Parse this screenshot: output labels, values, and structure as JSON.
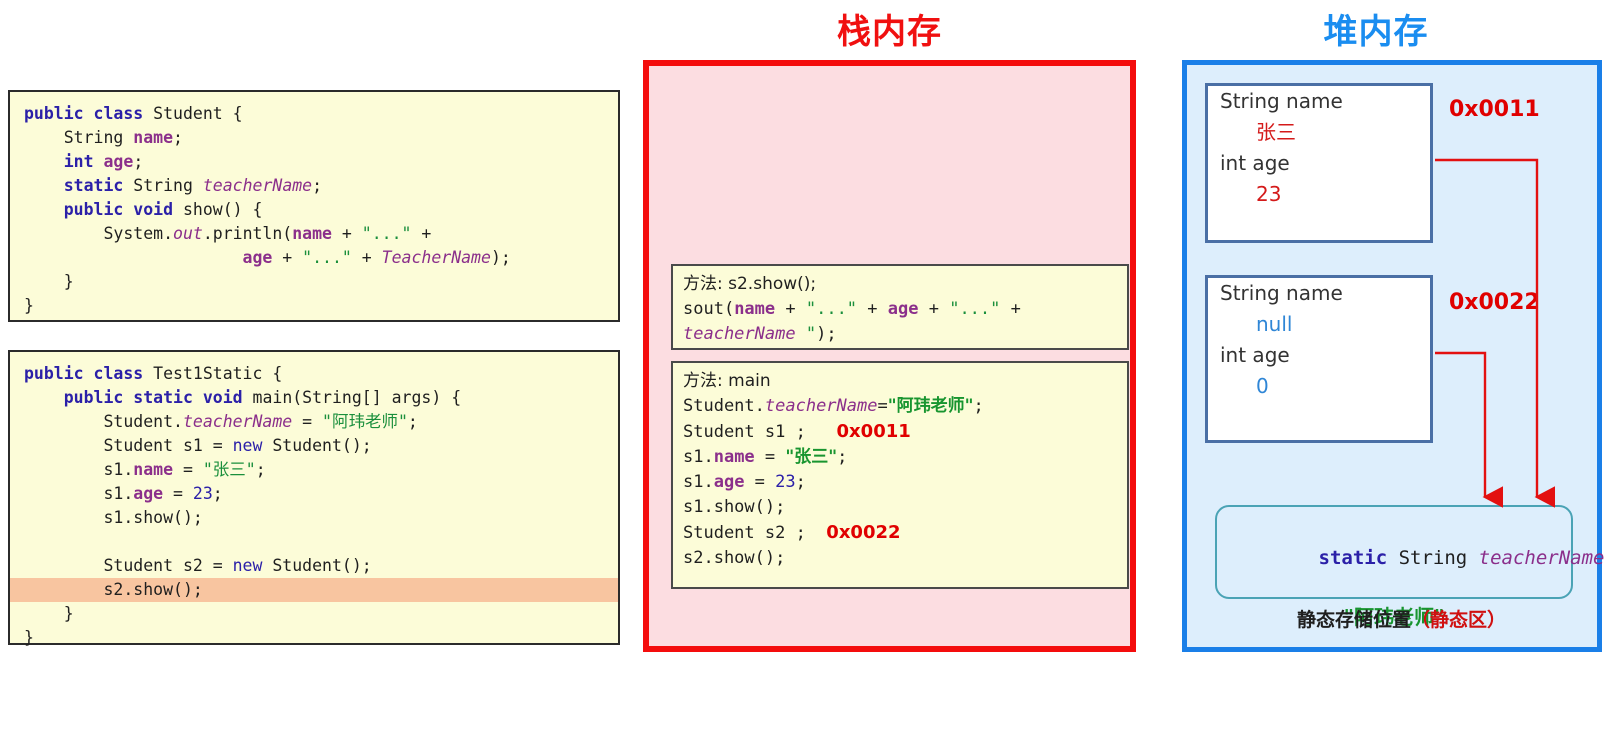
{
  "left_panel": {
    "student_class_code": [
      [
        {
          "t": "public ",
          "c": "kw"
        },
        {
          "t": "class ",
          "c": "kw"
        },
        {
          "t": "Student {",
          "c": "plain"
        }
      ],
      [
        {
          "t": "    String ",
          "c": "plain"
        },
        {
          "t": "name",
          "c": "fld"
        },
        {
          "t": ";",
          "c": "plain"
        }
      ],
      [
        {
          "t": "    ",
          "c": "plain"
        },
        {
          "t": "int ",
          "c": "kw"
        },
        {
          "t": "age",
          "c": "fld"
        },
        {
          "t": ";",
          "c": "plain"
        }
      ],
      [
        {
          "t": "    ",
          "c": "plain"
        },
        {
          "t": "static ",
          "c": "kw"
        },
        {
          "t": "String ",
          "c": "plain"
        },
        {
          "t": "teacherName",
          "c": "fld-i"
        },
        {
          "t": ";",
          "c": "plain"
        }
      ],
      [
        {
          "t": "    ",
          "c": "plain"
        },
        {
          "t": "public ",
          "c": "kw"
        },
        {
          "t": "void ",
          "c": "kw"
        },
        {
          "t": "show() {",
          "c": "plain"
        }
      ],
      [
        {
          "t": "        System.",
          "c": "plain"
        },
        {
          "t": "out",
          "c": "fld-i"
        },
        {
          "t": ".println(",
          "c": "plain"
        },
        {
          "t": "name",
          "c": "fld"
        },
        {
          "t": " + ",
          "c": "plain"
        },
        {
          "t": "\"...\"",
          "c": "str"
        },
        {
          "t": " +",
          "c": "plain"
        }
      ],
      [
        {
          "t": "                      ",
          "c": "plain"
        },
        {
          "t": "age",
          "c": "fld"
        },
        {
          "t": " + ",
          "c": "plain"
        },
        {
          "t": "\"...\"",
          "c": "str"
        },
        {
          "t": " + ",
          "c": "plain"
        },
        {
          "t": "TeacherName",
          "c": "fld-i"
        },
        {
          "t": ");",
          "c": "plain"
        }
      ],
      [
        {
          "t": "    }",
          "c": "plain"
        }
      ],
      [
        {
          "t": "}",
          "c": "plain"
        }
      ]
    ],
    "test_class_code": [
      {
        "highlight": false,
        "spans": [
          {
            "t": "public ",
            "c": "kw"
          },
          {
            "t": "class ",
            "c": "kw"
          },
          {
            "t": "Test1Static {",
            "c": "plain"
          }
        ]
      },
      {
        "highlight": false,
        "spans": [
          {
            "t": "    ",
            "c": "plain"
          },
          {
            "t": "public ",
            "c": "kw"
          },
          {
            "t": "static ",
            "c": "kw"
          },
          {
            "t": "void ",
            "c": "kw"
          },
          {
            "t": "main(String[] args) {",
            "c": "plain"
          }
        ]
      },
      {
        "highlight": false,
        "spans": [
          {
            "t": "        Student.",
            "c": "plain"
          },
          {
            "t": "teacherName",
            "c": "fld-i"
          },
          {
            "t": " = ",
            "c": "plain"
          },
          {
            "t": "\"阿玮老师\"",
            "c": "str"
          },
          {
            "t": ";",
            "c": "plain"
          }
        ]
      },
      {
        "highlight": false,
        "spans": [
          {
            "t": "        Student s1 = ",
            "c": "plain"
          },
          {
            "t": "new ",
            "c": "kw2"
          },
          {
            "t": "Student();",
            "c": "plain"
          }
        ]
      },
      {
        "highlight": false,
        "spans": [
          {
            "t": "        s1.",
            "c": "plain"
          },
          {
            "t": "name",
            "c": "fld"
          },
          {
            "t": " = ",
            "c": "plain"
          },
          {
            "t": "\"张三\"",
            "c": "str"
          },
          {
            "t": ";",
            "c": "plain"
          }
        ]
      },
      {
        "highlight": false,
        "spans": [
          {
            "t": "        s1.",
            "c": "plain"
          },
          {
            "t": "age",
            "c": "fld"
          },
          {
            "t": " = ",
            "c": "plain"
          },
          {
            "t": "23",
            "c": "num"
          },
          {
            "t": ";",
            "c": "plain"
          }
        ]
      },
      {
        "highlight": false,
        "spans": [
          {
            "t": "        s1.show();",
            "c": "plain"
          }
        ]
      },
      {
        "highlight": false,
        "spans": [
          {
            "t": " ",
            "c": "plain"
          }
        ]
      },
      {
        "highlight": false,
        "spans": [
          {
            "t": "        Student s2 = ",
            "c": "plain"
          },
          {
            "t": "new ",
            "c": "kw2"
          },
          {
            "t": "Student();",
            "c": "plain"
          }
        ]
      },
      {
        "highlight": true,
        "spans": [
          {
            "t": "        s2.show();",
            "c": "plain"
          }
        ]
      },
      {
        "highlight": false,
        "spans": [
          {
            "t": "    }",
            "c": "plain"
          }
        ]
      },
      {
        "highlight": false,
        "spans": [
          {
            "t": "}",
            "c": "plain"
          }
        ]
      }
    ]
  },
  "stack": {
    "title": "栈内存",
    "border_color": "#f40d0d",
    "fill_color": "#fcdde1",
    "frames": [
      {
        "name": "s2-show-frame",
        "lines": [
          [
            {
              "t": "方法: s2.show();",
              "c": "plain",
              "cjk": true
            }
          ],
          [
            {
              "t": "sout(",
              "c": "plain"
            },
            {
              "t": "name",
              "c": "fld"
            },
            {
              "t": " + ",
              "c": "plain"
            },
            {
              "t": "\"...\"",
              "c": "str"
            },
            {
              "t": " + ",
              "c": "plain"
            },
            {
              "t": "age",
              "c": "fld"
            },
            {
              "t": " + ",
              "c": "plain"
            },
            {
              "t": "\"...\"",
              "c": "str"
            },
            {
              "t": " +",
              "c": "plain"
            }
          ],
          [
            {
              "t": "teacherName",
              "c": "fld-i"
            },
            {
              "t": " ",
              "c": "plain"
            },
            {
              "t": "\"",
              "c": "str"
            },
            {
              "t": ");",
              "c": "plain"
            }
          ]
        ]
      },
      {
        "name": "main-frame",
        "lines": [
          [
            {
              "t": "方法: main",
              "c": "plain",
              "cjk": true
            }
          ],
          [
            {
              "t": "Student.",
              "c": "plain"
            },
            {
              "t": "teacherName",
              "c": "fld-i"
            },
            {
              "t": "=",
              "c": "plain"
            },
            {
              "t": "\"阿玮老师\"",
              "c": "strcn"
            },
            {
              "t": ";",
              "c": "plain"
            }
          ],
          [
            {
              "t": "Student s1 ;   ",
              "c": "plain"
            },
            {
              "t": "0x0011",
              "c": "addr"
            }
          ],
          [
            {
              "t": "s1.",
              "c": "plain"
            },
            {
              "t": "name",
              "c": "fld"
            },
            {
              "t": " = ",
              "c": "plain"
            },
            {
              "t": "\"张三\"",
              "c": "strcn"
            },
            {
              "t": ";",
              "c": "plain"
            }
          ],
          [
            {
              "t": "s1.",
              "c": "plain"
            },
            {
              "t": "age",
              "c": "fld"
            },
            {
              "t": " = ",
              "c": "plain"
            },
            {
              "t": "23",
              "c": "num"
            },
            {
              "t": ";",
              "c": "plain"
            }
          ],
          [
            {
              "t": "s1.show();",
              "c": "plain"
            }
          ],
          [
            {
              "t": "Student s2 ;  ",
              "c": "plain"
            },
            {
              "t": "0x0022",
              "c": "addr"
            }
          ],
          [
            {
              "t": "s2.show();",
              "c": "plain"
            }
          ]
        ]
      }
    ]
  },
  "heap": {
    "title": "堆内存",
    "border_color": "#1a7fe8",
    "fill_color": "#ddeefc",
    "objects": [
      {
        "address": "0x0011",
        "fields": [
          {
            "label": "String name",
            "value": "张三",
            "value_color": "red"
          },
          {
            "label": "int age",
            "value": "23",
            "value_color": "red"
          }
        ]
      },
      {
        "address": "0x0022",
        "fields": [
          {
            "label": "String name",
            "value": "null",
            "value_color": "blue"
          },
          {
            "label": "int age",
            "value": "0",
            "value_color": "blue"
          }
        ]
      }
    ],
    "static_area": {
      "keyword": "static",
      "type": " String ",
      "name": "teacherName",
      "value": "\"阿玮老师\"",
      "caption_main": "静态存储位置",
      "caption_paren": "（静态区）"
    }
  }
}
